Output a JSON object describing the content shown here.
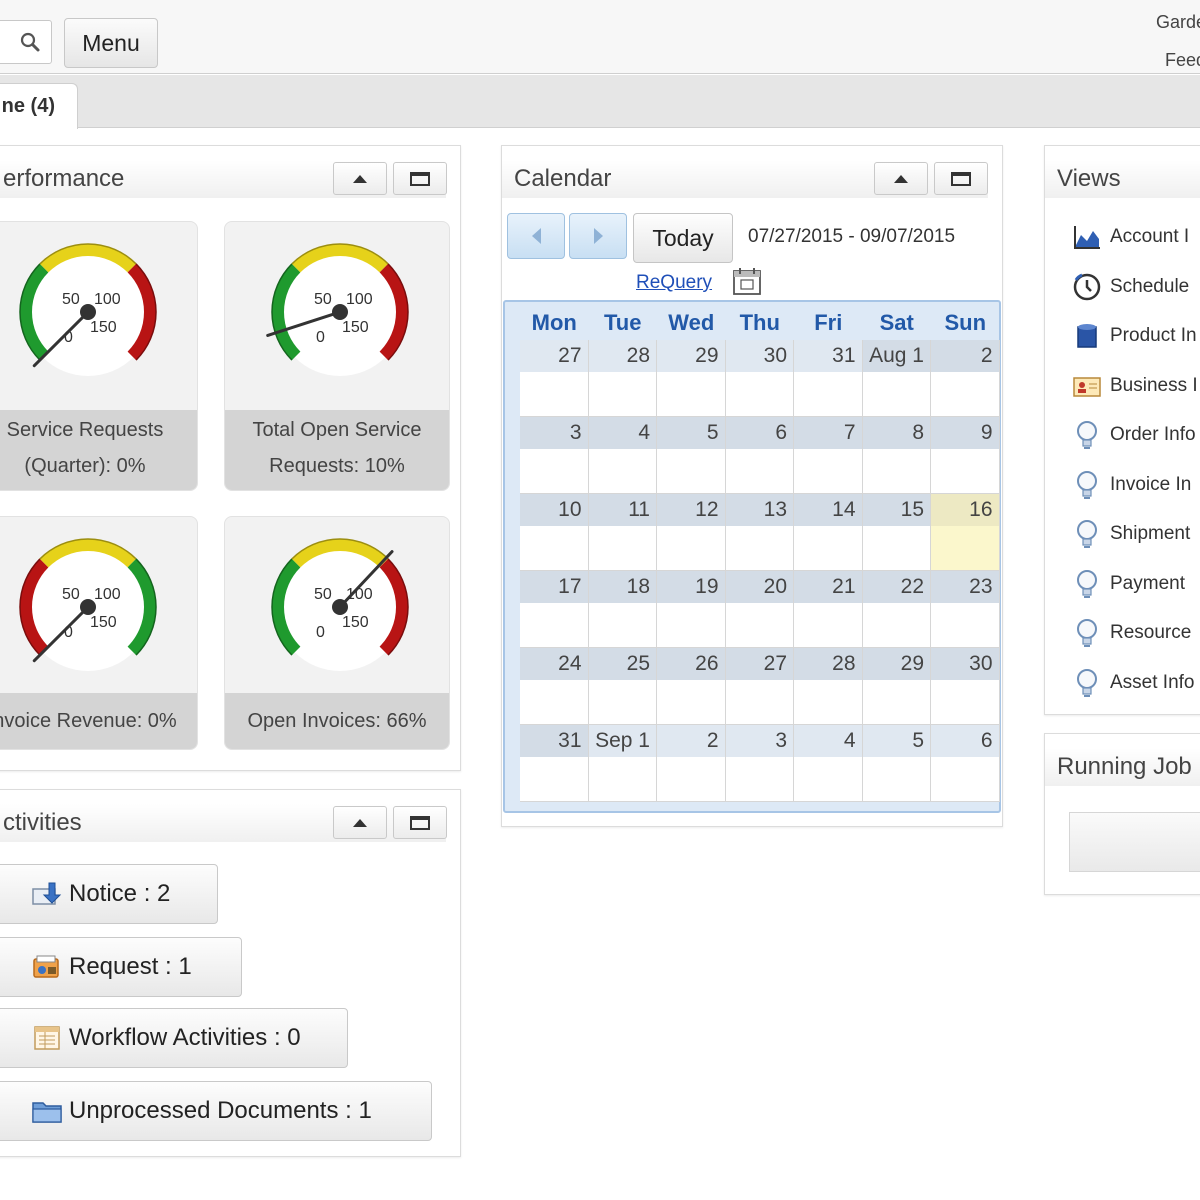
{
  "header": {
    "menu_label": "Menu",
    "user_line1": "Garde",
    "user_line2": "Feed"
  },
  "tabs": {
    "home_label": "ne (4)"
  },
  "performance": {
    "title": "erformance",
    "gauges": [
      {
        "caption_line1": "Service Requests",
        "caption_line2": "(Quarter): 0%",
        "value_pct": 0,
        "scheme": "green-yellow-red",
        "labels": [
          "0",
          "50",
          "100",
          "150"
        ]
      },
      {
        "caption_line1": "Total Open Service",
        "caption_line2": "Requests: 10%",
        "value_pct": 10,
        "scheme": "green-yellow-red",
        "labels": [
          "0",
          "50",
          "100",
          "150"
        ]
      },
      {
        "caption_line1": "nvoice Revenue: 0%",
        "caption_line2": "",
        "value_pct": 0,
        "scheme": "red-yellow-green",
        "labels": [
          "0",
          "50",
          "100",
          "150"
        ]
      },
      {
        "caption_line1": "Open Invoices: 66%",
        "caption_line2": "",
        "value_pct": 66,
        "scheme": "green-yellow-red",
        "labels": [
          "0",
          "50",
          "100",
          "150"
        ]
      }
    ]
  },
  "activities": {
    "title": "ctivities",
    "items": [
      {
        "label": "Notice : 2",
        "icon": "notice-icon"
      },
      {
        "label": "Request : 1",
        "icon": "request-icon"
      },
      {
        "label": "Workflow Activities : 0",
        "icon": "workflow-icon"
      },
      {
        "label": "Unprocessed Documents : 1",
        "icon": "folder-icon"
      }
    ]
  },
  "calendar": {
    "title": "Calendar",
    "today_label": "Today",
    "range": "07/27/2015 - 09/07/2015",
    "requery_label": "ReQuery",
    "weekdays": [
      "Mon",
      "Tue",
      "Wed",
      "Thu",
      "Fri",
      "Sat",
      "Sun"
    ],
    "weeks": [
      [
        "27",
        "28",
        "29",
        "30",
        "31",
        "Aug 1",
        "2"
      ],
      [
        "3",
        "4",
        "5",
        "6",
        "7",
        "8",
        "9"
      ],
      [
        "10",
        "11",
        "12",
        "13",
        "14",
        "15",
        "16"
      ],
      [
        "17",
        "18",
        "19",
        "20",
        "21",
        "22",
        "23"
      ],
      [
        "24",
        "25",
        "26",
        "27",
        "28",
        "29",
        "30"
      ],
      [
        "31",
        "Sep 1",
        "2",
        "3",
        "4",
        "5",
        "6"
      ]
    ],
    "today_cell": "16"
  },
  "views": {
    "title": "Views",
    "items": [
      {
        "label": "Account I",
        "icon": "area-chart-icon"
      },
      {
        "label": "Schedule",
        "icon": "clock-icon"
      },
      {
        "label": "Product In",
        "icon": "product-icon"
      },
      {
        "label": "Business I",
        "icon": "business-card-icon"
      },
      {
        "label": "Order Info",
        "icon": "lightbulb-icon"
      },
      {
        "label": "Invoice In",
        "icon": "lightbulb-icon"
      },
      {
        "label": "Shipment",
        "icon": "lightbulb-icon"
      },
      {
        "label": "Payment",
        "icon": "lightbulb-icon"
      },
      {
        "label": "Resource",
        "icon": "lightbulb-icon"
      },
      {
        "label": "Asset Info",
        "icon": "lightbulb-icon"
      }
    ]
  },
  "running_jobs": {
    "title": "Running Job"
  },
  "colors": {
    "accent_blue": "#2259a8",
    "today_highlight": "#fbf7cc",
    "link": "#1f4fb8"
  }
}
